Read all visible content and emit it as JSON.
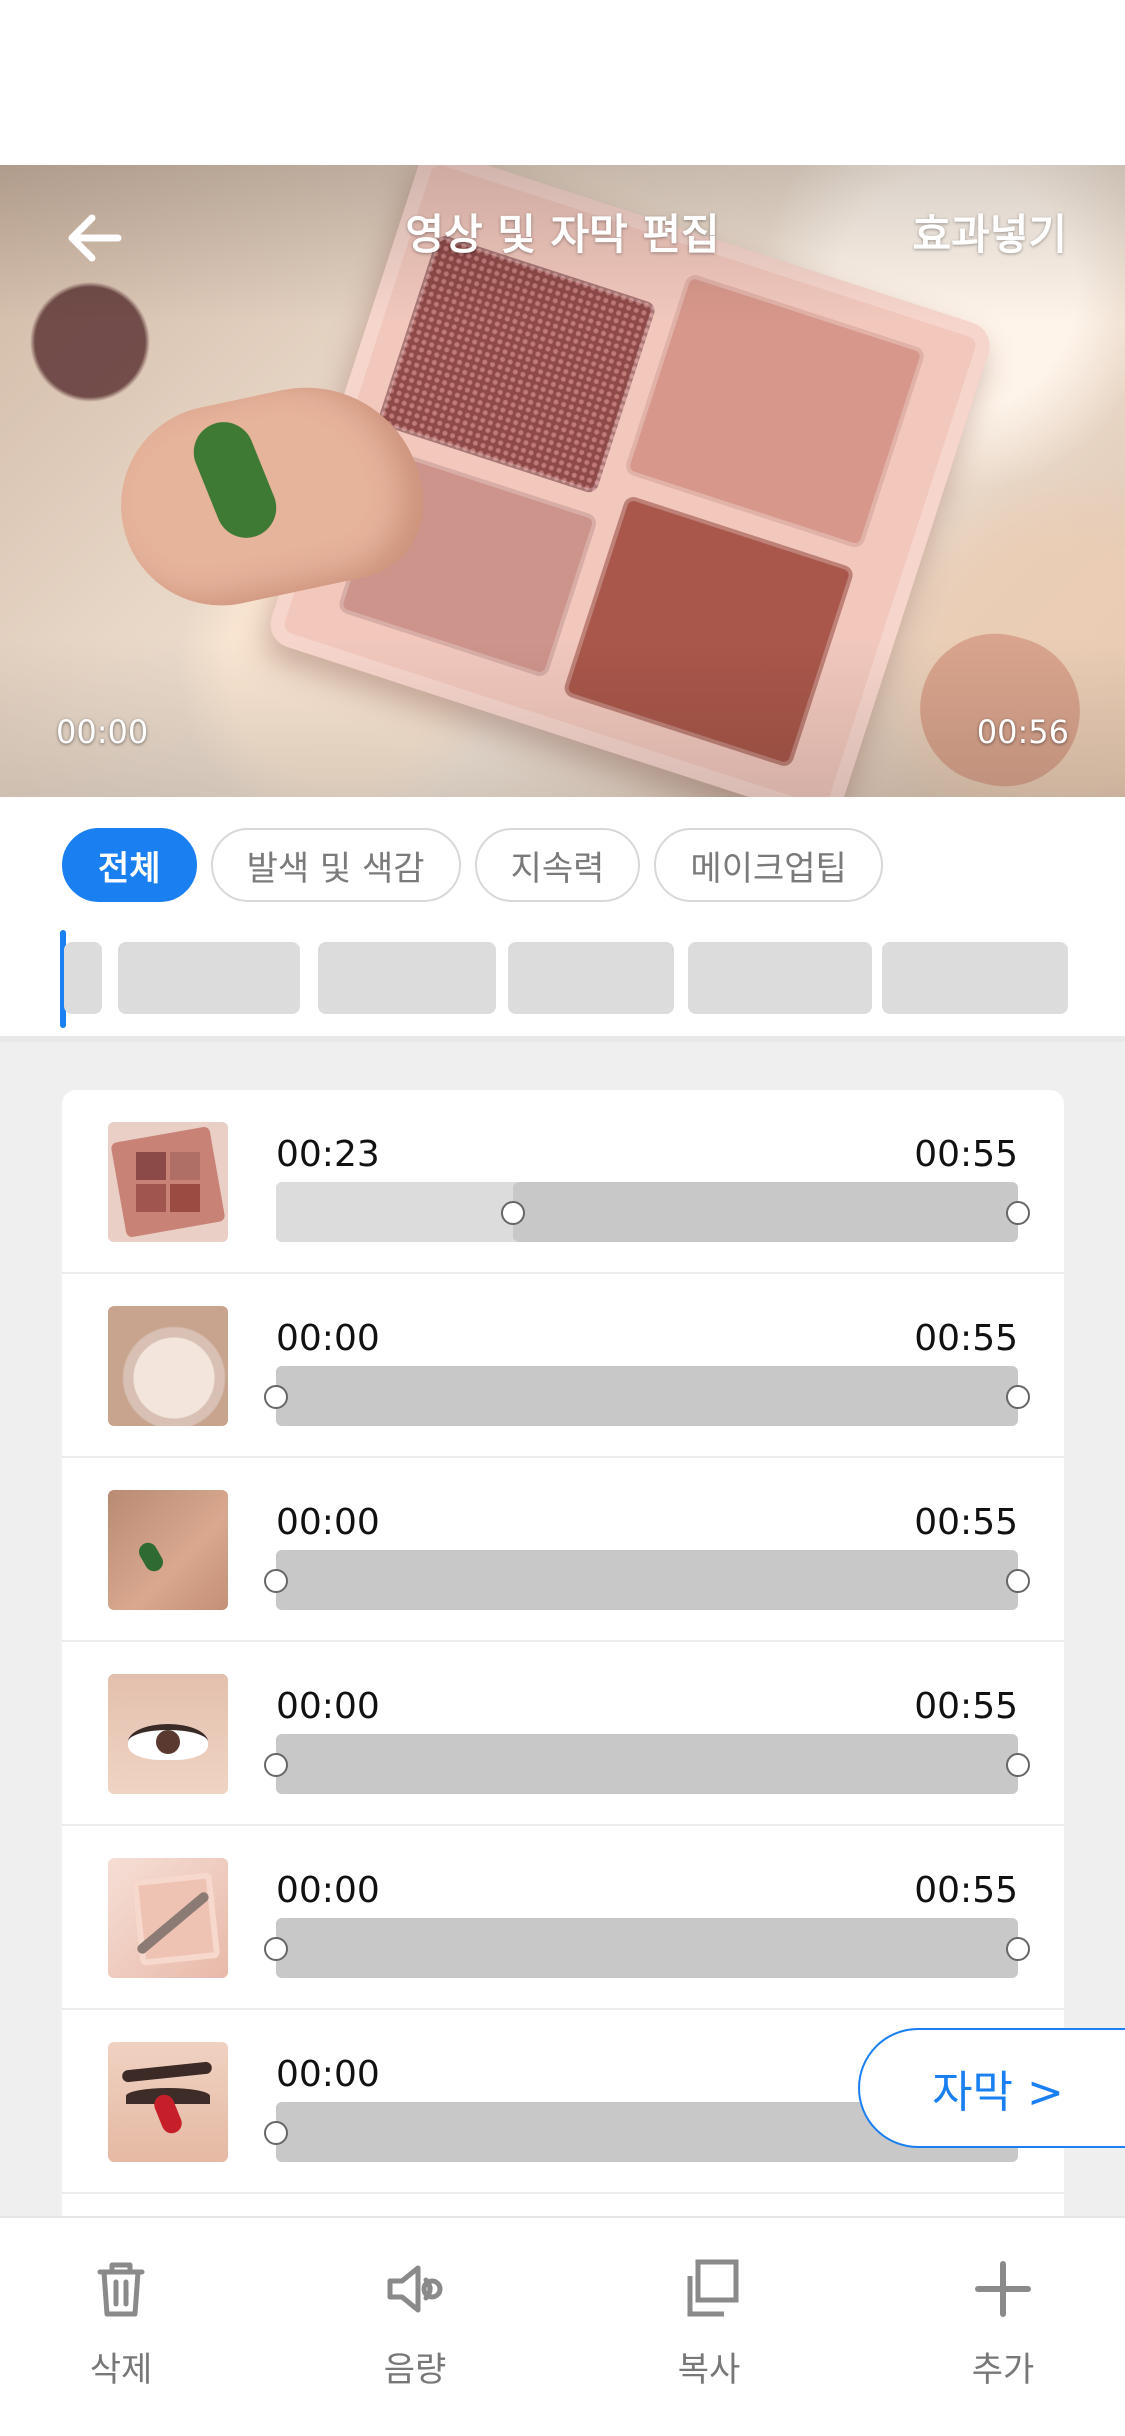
{
  "header": {
    "title": "영상 및 자막 편집",
    "action": "효과넣기"
  },
  "video": {
    "time_start": "00:00",
    "time_end": "00:56"
  },
  "tabs": [
    {
      "label": "전체",
      "active": true
    },
    {
      "label": "발색 및 색감",
      "active": false
    },
    {
      "label": "지속력",
      "active": false
    },
    {
      "label": "메이크업팁",
      "active": false
    }
  ],
  "clips": [
    {
      "start": "00:23",
      "end": "00:55",
      "range_start": 0.32,
      "range_end": 1.0
    },
    {
      "start": "00:00",
      "end": "00:55",
      "range_start": 0.0,
      "range_end": 1.0
    },
    {
      "start": "00:00",
      "end": "00:55",
      "range_start": 0.0,
      "range_end": 1.0
    },
    {
      "start": "00:00",
      "end": "00:55",
      "range_start": 0.0,
      "range_end": 1.0
    },
    {
      "start": "00:00",
      "end": "00:55",
      "range_start": 0.0,
      "range_end": 1.0
    },
    {
      "start": "00:00",
      "end": "",
      "range_start": 0.0,
      "range_end": 1.0
    }
  ],
  "subtitle_button": "자막 >",
  "toolbar": {
    "delete": "삭제",
    "volume": "음량",
    "copy": "복사",
    "add": "추가"
  },
  "colors": {
    "accent": "#1a7ff0",
    "track": "#c8c8c8"
  }
}
